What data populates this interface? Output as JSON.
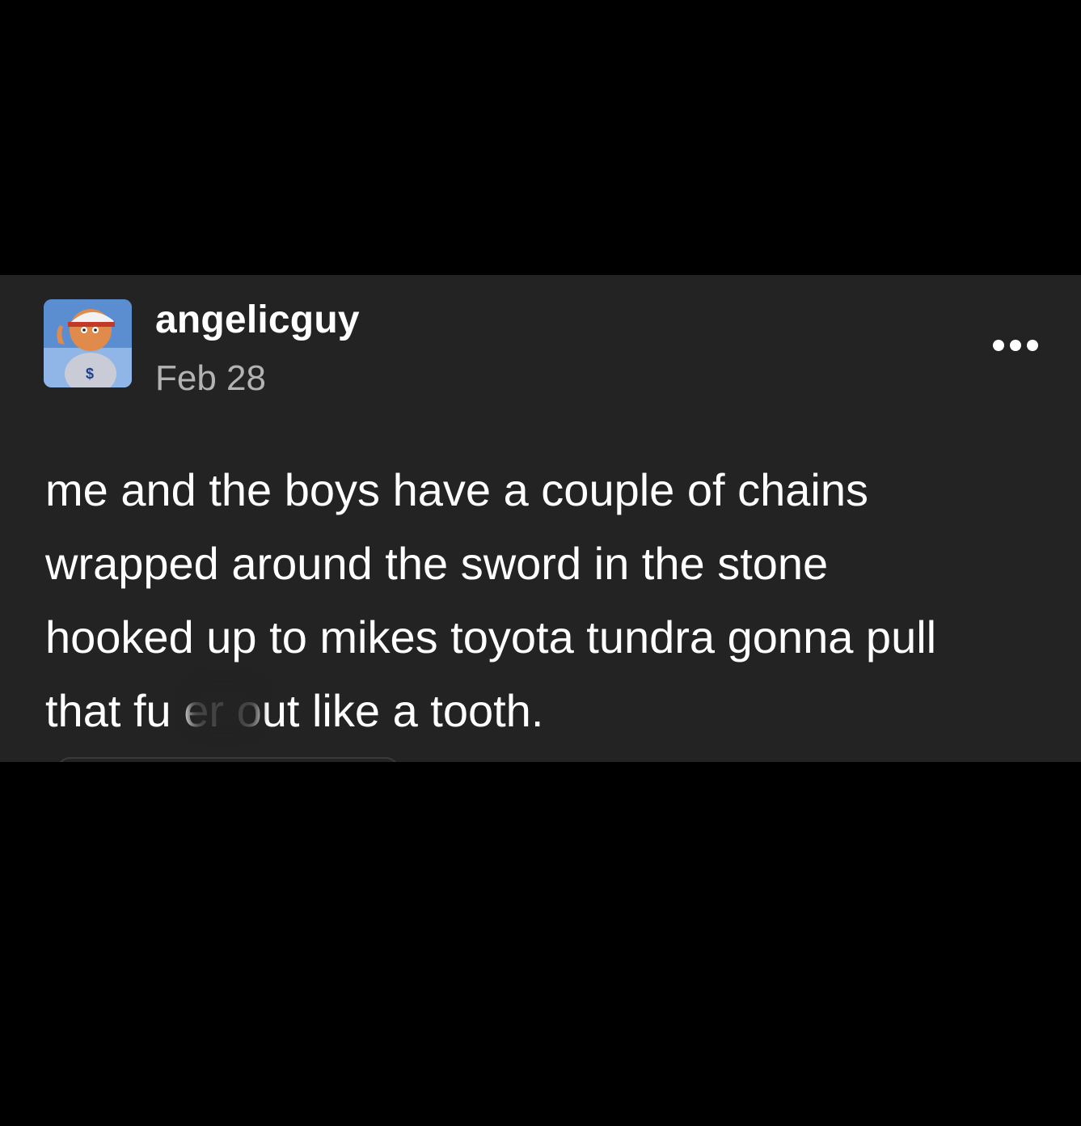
{
  "post": {
    "author": "angelicguy",
    "date": "Feb 28",
    "avatar_icon": "toy-figure-avatar-icon",
    "more_icon": "more-options-icon",
    "body": "me and the boys have a couple of chains\nwrapped around the sword in the stone\nhooked up to mikes toyota tundra gonna pull\nthat fu   er out like a tooth."
  },
  "colors": {
    "page_background": "#000000",
    "card_background": "#232323",
    "text_primary": "#ffffff",
    "text_secondary": "#b3b3b3"
  }
}
